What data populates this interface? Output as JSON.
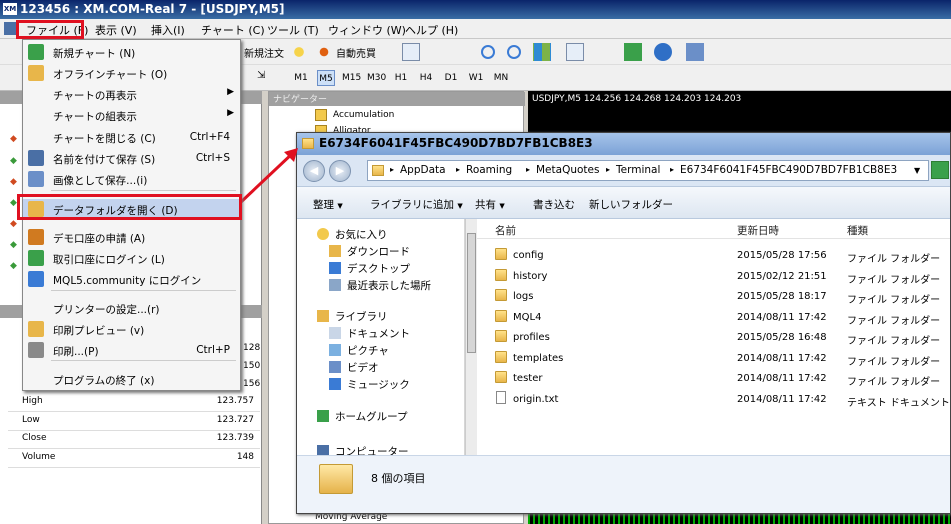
{
  "window": {
    "title": "123456 : XM.COM-Real 7 - [USDJPY,M5]"
  },
  "menubar": [
    {
      "label": "ファイル (F)"
    },
    {
      "label": "表示 (V)"
    },
    {
      "label": "挿入(I)"
    },
    {
      "label": "チャート (C)"
    },
    {
      "label": "ツール (T)"
    },
    {
      "label": "ウィンドウ (W)"
    },
    {
      "label": "ヘルプ (H)"
    }
  ],
  "toolbar": {
    "new_order": "新規注文",
    "auto_trading": "自動売買"
  },
  "timeframes": [
    "M1",
    "M5",
    "M15",
    "M30",
    "H1",
    "H4",
    "D1",
    "W1",
    "MN"
  ],
  "active_timeframe": "M5",
  "file_menu": {
    "items": [
      {
        "label": "新規チャート (N)",
        "shortcut": ""
      },
      {
        "label": "オフラインチャート (O)",
        "shortcut": ""
      },
      {
        "label": "チャートの再表示",
        "shortcut": "",
        "submenu": "▶"
      },
      {
        "label": "チャートの組表示",
        "shortcut": "",
        "submenu": "▶"
      },
      {
        "label": "チャートを閉じる (C)",
        "shortcut": "Ctrl+F4"
      },
      {
        "label": "名前を付けて保存 (S)",
        "shortcut": "Ctrl+S"
      },
      {
        "label": "画像として保存...(i)",
        "shortcut": ""
      },
      {
        "label": "データフォルダを開く (D)",
        "shortcut": ""
      },
      {
        "label": "デモ口座の申請 (A)",
        "shortcut": ""
      },
      {
        "label": "取引口座にログイン (L)",
        "shortcut": ""
      },
      {
        "label": "MQL5.community にログイン",
        "shortcut": ""
      },
      {
        "label": "プリンターの設定...(r)",
        "shortcut": ""
      },
      {
        "label": "印刷プレビュー (v)",
        "shortcut": ""
      },
      {
        "label": "印刷...(P)",
        "shortcut": "Ctrl+P"
      },
      {
        "label": "プログラムの終了 (x)",
        "shortcut": ""
      }
    ]
  },
  "data_window": {
    "partial_values": [
      "128",
      "150",
      "156"
    ],
    "rows": [
      {
        "label": "High",
        "value": "123.757"
      },
      {
        "label": "Low",
        "value": "123.727"
      },
      {
        "label": "Close",
        "value": "123.739"
      },
      {
        "label": "Volume",
        "value": "148"
      }
    ]
  },
  "navigator": {
    "header": "ナビゲーター",
    "items": [
      "Accumulation",
      "Alligator"
    ],
    "bottom_item": "Moving Average"
  },
  "chart": {
    "header": "USDJPY,M5  124.256 124.268 124.203 124.203"
  },
  "explorer": {
    "title": "E6734F6041F45FBC490D7BD7FB1CB8E3",
    "path": [
      "AppData",
      "Roaming",
      "MetaQuotes",
      "Terminal",
      "E6734F6041F45FBC490D7BD7FB1CB8E3"
    ],
    "commands": [
      {
        "label": "整理",
        "dropdown": "▼"
      },
      {
        "label": "ライブラリに追加",
        "dropdown": "▼"
      },
      {
        "label": "共有",
        "dropdown": "▼"
      },
      {
        "label": "書き込む"
      },
      {
        "label": "新しいフォルダー"
      }
    ],
    "tree": [
      {
        "label": "お気に入り",
        "level": 0
      },
      {
        "label": "ダウンロード",
        "level": 1
      },
      {
        "label": "デスクトップ",
        "level": 1
      },
      {
        "label": "最近表示した場所",
        "level": 1
      },
      {
        "label": "ライブラリ",
        "level": 0
      },
      {
        "label": "ドキュメント",
        "level": 1
      },
      {
        "label": "ピクチャ",
        "level": 1
      },
      {
        "label": "ビデオ",
        "level": 1
      },
      {
        "label": "ミュージック",
        "level": 1
      },
      {
        "label": "ホームグループ",
        "level": 0
      },
      {
        "label": "コンピューター",
        "level": 0
      }
    ],
    "columns": {
      "name": "名前",
      "date": "更新日時",
      "type": "種類"
    },
    "files": [
      {
        "name": "config",
        "date": "2015/05/28 17:56",
        "type": "ファイル フォルダー"
      },
      {
        "name": "history",
        "date": "2015/02/12 21:51",
        "type": "ファイル フォルダー"
      },
      {
        "name": "logs",
        "date": "2015/05/28 18:17",
        "type": "ファイル フォルダー"
      },
      {
        "name": "MQL4",
        "date": "2014/08/11 17:42",
        "type": "ファイル フォルダー"
      },
      {
        "name": "profiles",
        "date": "2015/05/28 16:48",
        "type": "ファイル フォルダー"
      },
      {
        "name": "templates",
        "date": "2014/08/11 17:42",
        "type": "ファイル フォルダー"
      },
      {
        "name": "tester",
        "date": "2014/08/11 17:42",
        "type": "ファイル フォルダー"
      },
      {
        "name": "origin.txt",
        "date": "2014/08/11 17:42",
        "type": "テキスト ドキュメント"
      }
    ],
    "status": "8 個の項目"
  },
  "colors": {
    "highlight": "#e01020",
    "menu_selection": "#c3d3ee",
    "chart_bg": "#000000"
  }
}
